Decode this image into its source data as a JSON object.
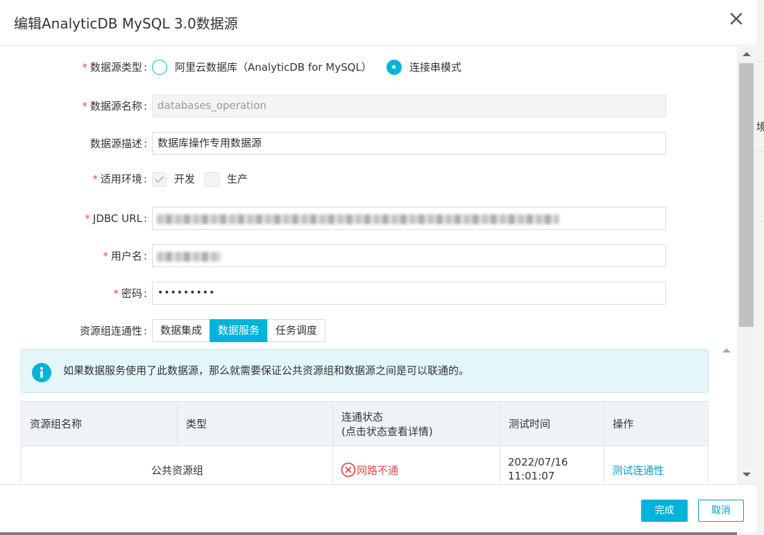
{
  "dialog": {
    "title": "编辑AnalyticDB MySQL 3.0数据源",
    "confirm_label": "完成",
    "cancel_label": "取消"
  },
  "form": {
    "type": {
      "label": "数据源类型",
      "option1": "阿里云数据库（AnalyticDB for MySQL）",
      "option2": "连接串模式",
      "selected": "连接串模式"
    },
    "name": {
      "label": "数据源名称",
      "value": "databases_operation"
    },
    "description": {
      "label": "数据源描述",
      "value": "数据库操作专用数据源"
    },
    "environment": {
      "label": "适用环境",
      "option1": "开发",
      "option1_checked": true,
      "option2": "生产",
      "option2_checked": false
    },
    "jdbc": {
      "label": "JDBC URL"
    },
    "username": {
      "label": "用户名"
    },
    "password": {
      "label": "密码",
      "value": "•••••••••"
    },
    "connectivity": {
      "label": "资源组连通性",
      "tabs": [
        "数据集成",
        "数据服务",
        "任务调度"
      ],
      "active_tab": "数据服务"
    }
  },
  "notice": {
    "text": "如果数据服务使用了此数据源，那么就需要保证公共资源组和数据源之间是可以联通的。"
  },
  "table": {
    "headers": {
      "name": "资源组名称",
      "type": "类型",
      "status_line1": "连通状态",
      "status_line2": "(点击状态查看详情)",
      "time": "测试时间",
      "action": "操作"
    },
    "rows": [
      {
        "name": "公共资源组",
        "type": "",
        "status": "网路不通",
        "time_line1": "2022/07/16",
        "time_line2": "11:01:07",
        "action": "测试连通性"
      }
    ]
  },
  "background": {
    "partial_char": "境"
  },
  "colors": {
    "accent": "#00b3d9",
    "error": "#e14a4a",
    "link": "#00a2c7"
  }
}
